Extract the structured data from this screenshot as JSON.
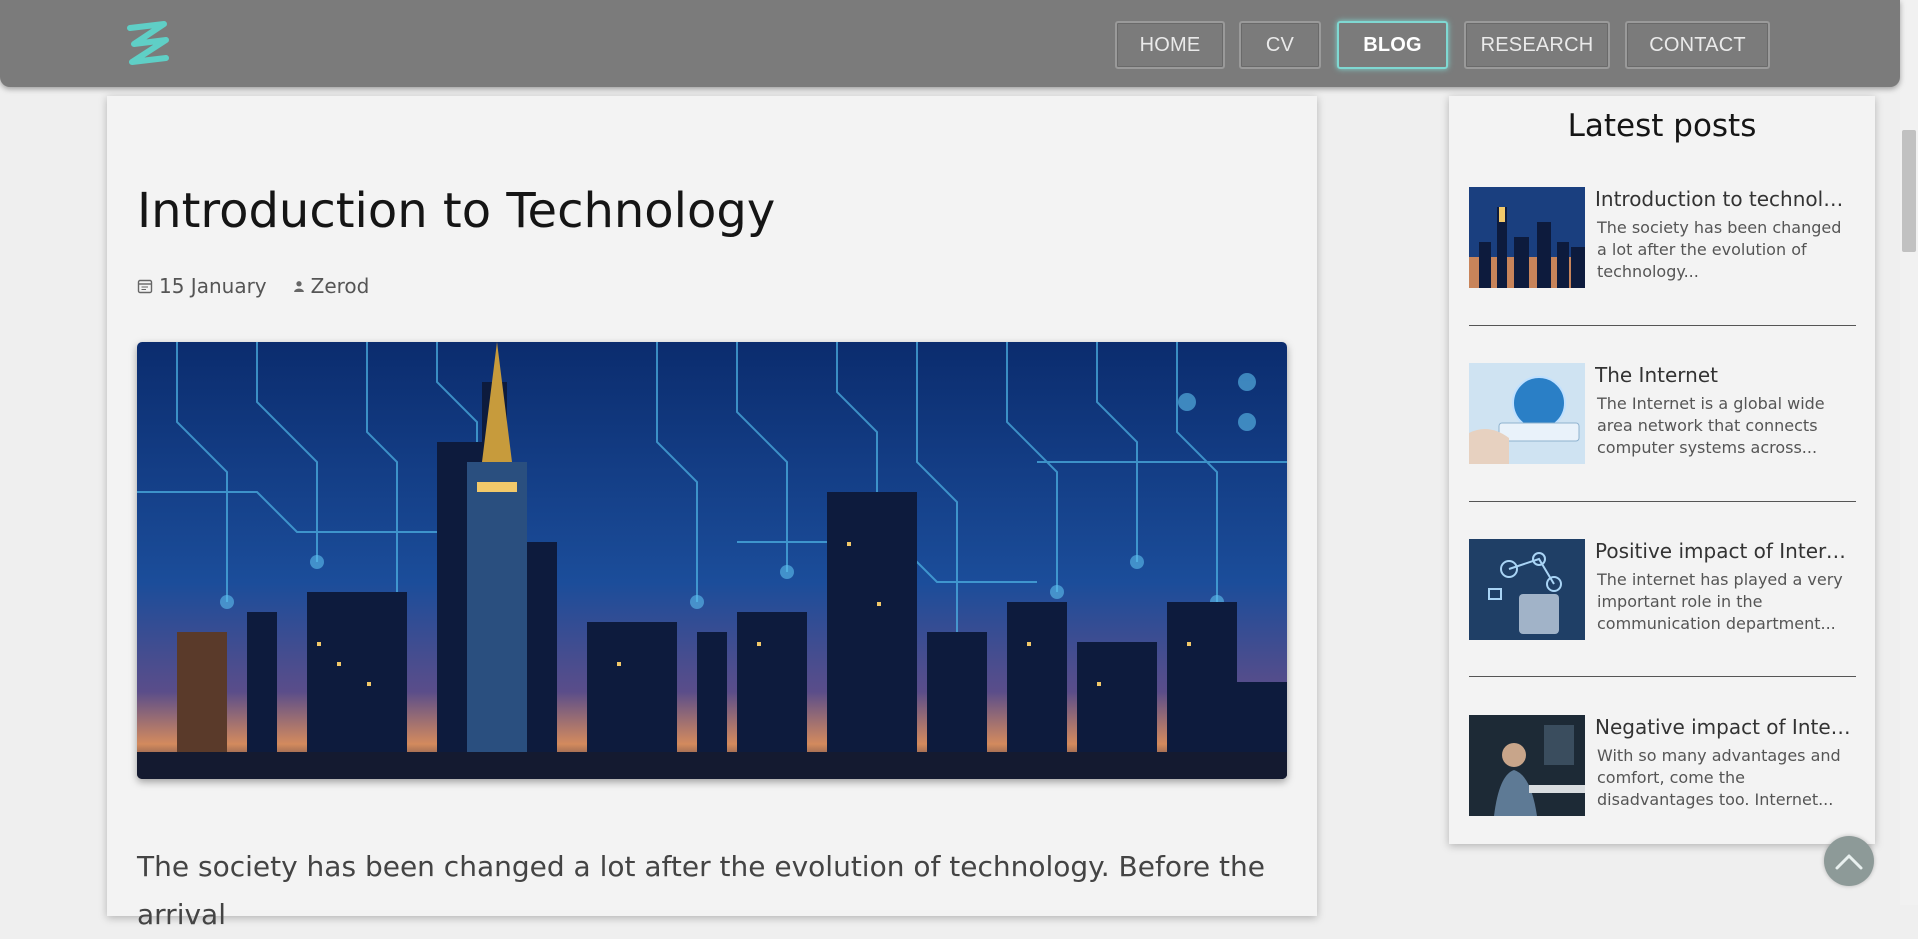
{
  "nav": {
    "items": [
      {
        "label": "HOME"
      },
      {
        "label": "CV"
      },
      {
        "label": "BLOG"
      },
      {
        "label": "RESEARCH"
      },
      {
        "label": "CONTACT"
      }
    ],
    "active": "BLOG",
    "accent_color": "#7fd8d2",
    "logo_icon": "z-logo-icon"
  },
  "article": {
    "title": "Introduction to Technology",
    "date": "15 January",
    "author": "Zerod",
    "date_icon": "calendar-icon",
    "author_icon": "user-icon",
    "image_alt": "city-skyline-circuit-image",
    "body": "The society has been changed a lot after the evolution of technology. Before the arrival"
  },
  "sidebar": {
    "title": "Latest posts",
    "posts": [
      {
        "title": "Introduction to technology",
        "excerpt": "The society has been changed a lot after the evolution of technology..."
      },
      {
        "title": "The Internet",
        "excerpt": "The Internet is a global wide area network that connects computer systems across..."
      },
      {
        "title": "Positive impact of Interne...",
        "excerpt": "The internet has played a very important role in the communication department..."
      },
      {
        "title": "Negative impact of Intern...",
        "excerpt": "With so many advantages and comfort, come the disadvantages too. Internet..."
      }
    ]
  },
  "back_to_top_icon": "chevron-up-icon"
}
